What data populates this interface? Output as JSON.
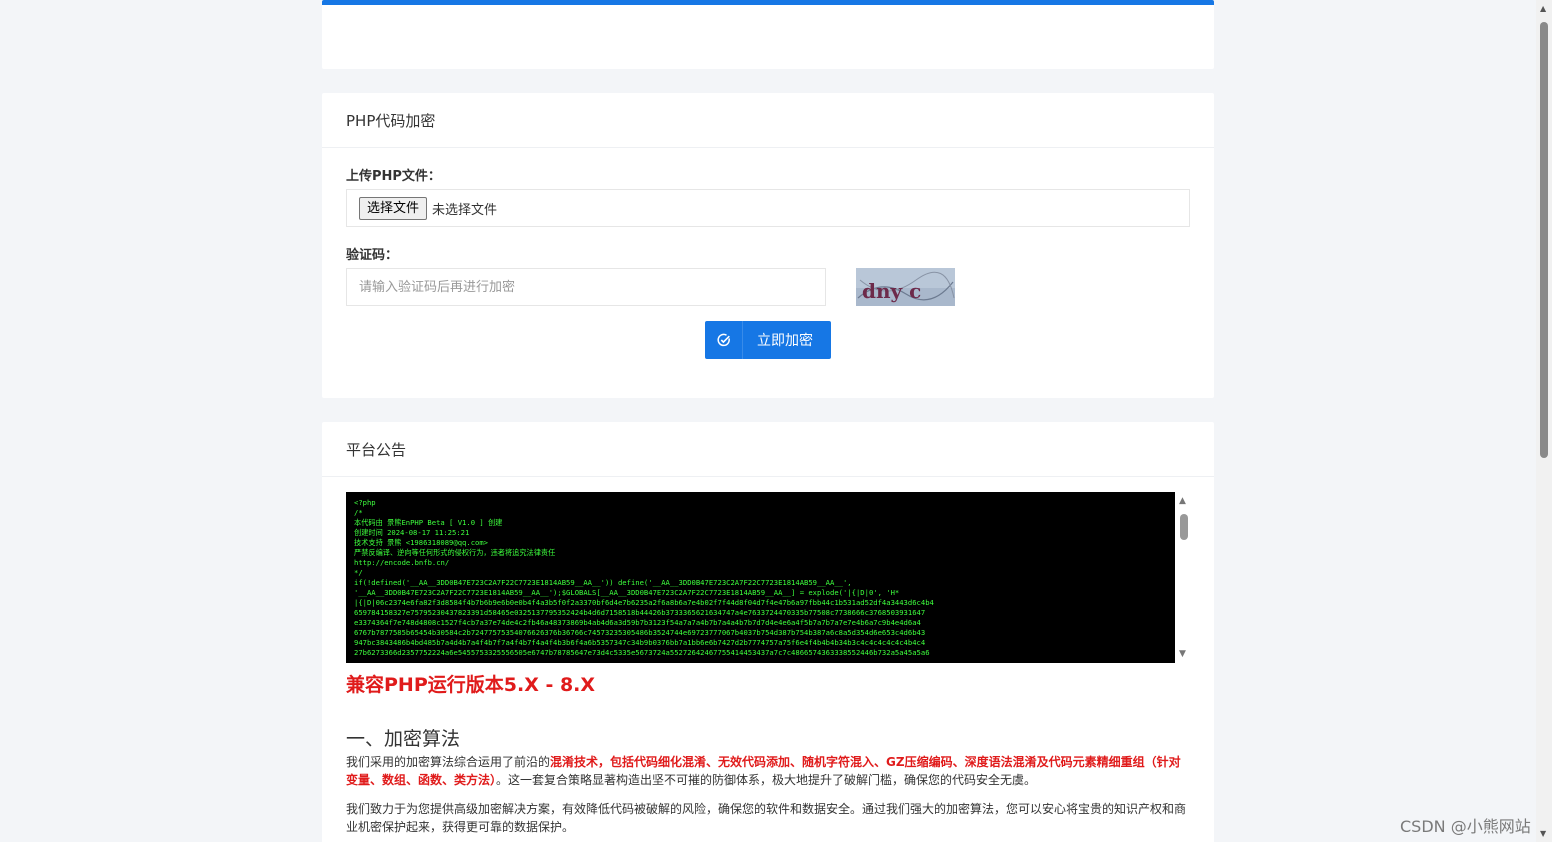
{
  "form_card": {
    "title": "PHP代码加密",
    "upload_label": "上传PHP文件：",
    "choose_file_button": "选择文件",
    "file_status": "未选择文件",
    "captcha_label": "验证码：",
    "captcha_placeholder": "请输入验证码后再进行加密",
    "captcha_text": "dny c",
    "submit_button": "立即加密"
  },
  "notice_card": {
    "title": "平台公告",
    "code_lines": [
      "<?php",
      "/*",
      " 本代码由 景熊EnPHP Beta [ V1.0 ] 创建",
      " 创建时间 2024-08-17 11:25:21",
      " 技术支持 景熊 <1986318089@qq.com>",
      " 严禁反编译、逆向等任何形式的侵权行为，违者将追究法律责任",
      " http://encode.bnfb.cn/",
      "*/",
      "if(!defined('__AA__3DD0B47E723C2A7F22C7723E1814AB59__AA__')) define('__AA__3DD0B47E723C2A7F22C7723E1814AB59__AA__',",
      "'__AA__3DD0B47E723C2A7F22C7723E1814AB59__AA__');$GLOBALS[__AA__3DD0B47E723C2A7F22C7723E1814AB59__AA__] = explode('|{|D|0', 'H*",
      "|{|D|06c2374e6fa82f3d8584f4b7b6b9e6b0e0b4f4a3b5f0f2a3370bf6d4e7b6235a2f6a8b6a7e4b02f7f44d8f04d7f4e47b6a97fbb44c1b531ad52df4a3443d6c4b4",
      "659784158327e75795230437823391d58465e0325137795352424b4d6d7158518b44426b3733365621634747a4e7633724470335b77508c7738666c3768503931647",
      "e3374364f7e748d4808c1527f4cb7a37e74de4c2fb46a48373869b4ab4d6a3d59b7b3123f54a7a7a4b7b7a4a4b7b7d7d4e4e6a4f5b7a7b7a7e7e4b6a7c9b4e4d6a4",
      "6767b7877585b65454b30584c2b72477575354076626376b36766c74573235305486b3524744e69723777067b4037b754d387b754b387a6c8a5d354d6e653c4d6b43",
      "947bc3843486b4bd485b7a4d4b7a4f4b7f7a4f4b7f4a4f4b3b6f4a6b5357347c34b9b0376bb7a1bb6e6b7427d2b7774757a75f6e4f4b4b4b34b3c4c4c4c4c4c4b4c4",
      "27b6273366d2357752224a6e5455753325556505e6747b78785647e73d4c5335e5673724a55272642467755414453437a7c7c4866574363338552446b732a5a45a5a6"
    ],
    "compat_text": "兼容PHP运行版本5.X - 8.X",
    "section_title": "一、加密算法",
    "para1_a": "我们采用的加密算法综合运用了前沿的",
    "para1_hl": "混淆技术，包括代码细化混淆、无效代码添加、随机字符混入、GZ压缩编码、深度语法混淆及代码元素精细重组（针对变量、数组、函数、类方法）",
    "para1_b": "。这一套复合策略显著构造出坚不可摧的防御体系，极大地提升了破解门槛，确保您的代码安全无虞。",
    "para2": "我们致力于为您提供高级加密解决方案，有效降低代码被破解的风险，确保您的软件和数据安全。通过我们强大的加密算法，您可以安心将宝贵的知识产权和商业机密保护起来，获得更可靠的数据保护。"
  },
  "watermark": "CSDN @小熊网站",
  "colors": {
    "accent": "#1677e5",
    "highlight": "#e01b1b",
    "code_text": "#3dff3d"
  }
}
